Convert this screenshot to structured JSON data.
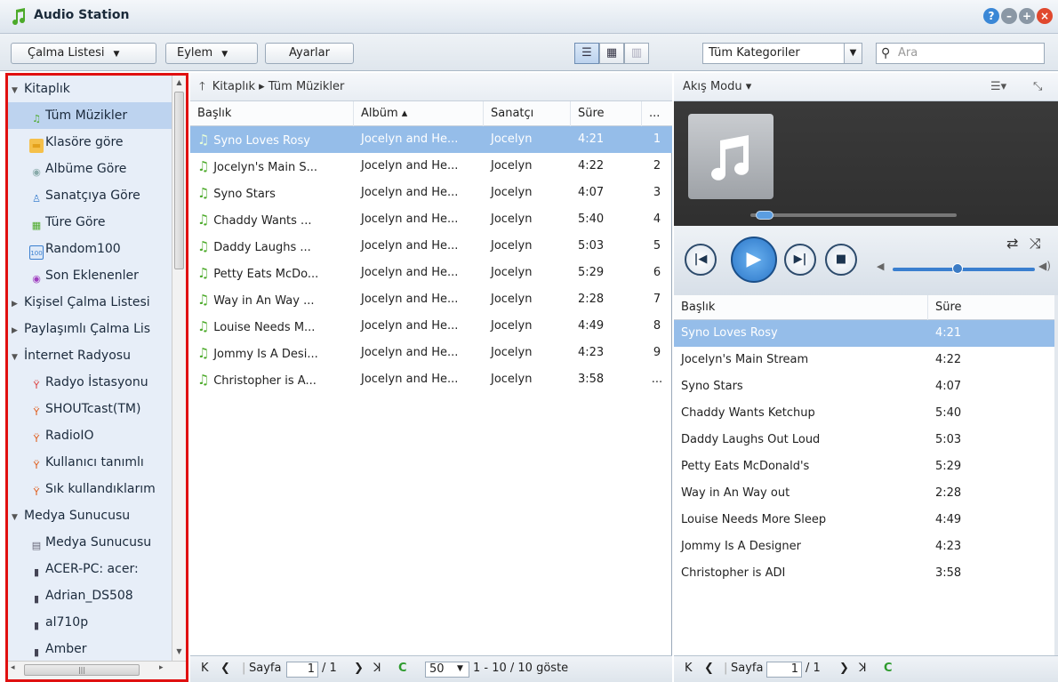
{
  "window": {
    "title": "Audio Station"
  },
  "toolbar": {
    "playlist_label": "Çalma Listesi",
    "action_label": "Eylem",
    "settings_label": "Ayarlar",
    "category_value": "Tüm Kategoriler",
    "search_placeholder": "Ara"
  },
  "sidebar": {
    "items": [
      {
        "label": "Kitaplık",
        "type": "group",
        "expanded": true
      },
      {
        "label": "Tüm Müzikler",
        "type": "item",
        "icon": "music-note-icon",
        "selected": true
      },
      {
        "label": "Klasöre göre",
        "type": "item",
        "icon": "folder-icon"
      },
      {
        "label": "Albüme Göre",
        "type": "item",
        "icon": "disc-icon"
      },
      {
        "label": "Sanatçıya Göre",
        "type": "item",
        "icon": "person-icon"
      },
      {
        "label": "Türe Göre",
        "type": "item",
        "icon": "genre-icon"
      },
      {
        "label": "Random100",
        "type": "item",
        "icon": "random100-icon"
      },
      {
        "label": "Son Eklenenler",
        "type": "item",
        "icon": "recent-icon"
      },
      {
        "label": "Kişisel Çalma Listesi",
        "type": "group",
        "expanded": false
      },
      {
        "label": "Paylaşımlı Çalma Lis",
        "type": "group",
        "expanded": false
      },
      {
        "label": "İnternet Radyosu",
        "type": "group",
        "expanded": true
      },
      {
        "label": "Radyo İstasyonu",
        "type": "item",
        "icon": "radio-add-icon"
      },
      {
        "label": "SHOUTcast(TM)",
        "type": "item",
        "icon": "radio-tower-icon"
      },
      {
        "label": "RadioIO",
        "type": "item",
        "icon": "radio-tower-icon"
      },
      {
        "label": "Kullanıcı tanımlı",
        "type": "item",
        "icon": "radio-tower-icon"
      },
      {
        "label": "Sık kullandıklarım",
        "type": "item",
        "icon": "radio-tower-icon"
      },
      {
        "label": "Medya Sunucusu",
        "type": "group",
        "expanded": true
      },
      {
        "label": "Medya Sunucusu",
        "type": "item",
        "icon": "media-server-icon"
      },
      {
        "label": "ACER-PC: acer:",
        "type": "item",
        "icon": "server-icon"
      },
      {
        "label": "Adrian_DS508",
        "type": "item",
        "icon": "server-icon"
      },
      {
        "label": "al710p",
        "type": "item",
        "icon": "server-icon"
      },
      {
        "label": "Amber",
        "type": "item",
        "icon": "server-icon"
      }
    ]
  },
  "library": {
    "breadcrumb": "Kitaplık ▸ Tüm Müzikler",
    "columns": [
      "Başlık",
      "Albüm ▴",
      "Sanatçı",
      "Süre",
      "..."
    ],
    "rows": [
      {
        "title": "Syno Loves Rosy",
        "album": "Jocelyn and He...",
        "artist": "Jocelyn",
        "duration": "4:21",
        "num": "1",
        "selected": true
      },
      {
        "title": "Jocelyn's Main S...",
        "album": "Jocelyn and He...",
        "artist": "Jocelyn",
        "duration": "4:22",
        "num": "2"
      },
      {
        "title": "Syno Stars",
        "album": "Jocelyn and He...",
        "artist": "Jocelyn",
        "duration": "4:07",
        "num": "3"
      },
      {
        "title": "Chaddy Wants ...",
        "album": "Jocelyn and He...",
        "artist": "Jocelyn",
        "duration": "5:40",
        "num": "4"
      },
      {
        "title": "Daddy Laughs ...",
        "album": "Jocelyn and He...",
        "artist": "Jocelyn",
        "duration": "5:03",
        "num": "5"
      },
      {
        "title": "Petty Eats McDo...",
        "album": "Jocelyn and He...",
        "artist": "Jocelyn",
        "duration": "5:29",
        "num": "6"
      },
      {
        "title": "Way in An Way ...",
        "album": "Jocelyn and He...",
        "artist": "Jocelyn",
        "duration": "2:28",
        "num": "7"
      },
      {
        "title": "Louise Needs M...",
        "album": "Jocelyn and He...",
        "artist": "Jocelyn",
        "duration": "4:49",
        "num": "8"
      },
      {
        "title": "Jommy Is A Desi...",
        "album": "Jocelyn and He...",
        "artist": "Jocelyn",
        "duration": "4:23",
        "num": "9"
      },
      {
        "title": "Christopher is A...",
        "album": "Jocelyn and He...",
        "artist": "Jocelyn",
        "duration": "3:58",
        "num": "..."
      }
    ],
    "pager": {
      "page_label": "Sayfa",
      "page": "1",
      "total": "/ 1",
      "per_page": "50",
      "summary": "1 - 10 / 10 göste"
    }
  },
  "player": {
    "mode_label": "Akış Modu ▾",
    "progress": 0.03,
    "volume": 0.45,
    "columns": [
      "Başlık",
      "Süre"
    ],
    "playlist": [
      {
        "title": "Syno Loves Rosy",
        "duration": "4:21",
        "selected": true
      },
      {
        "title": "Jocelyn's Main Stream",
        "duration": "4:22"
      },
      {
        "title": "Syno Stars",
        "duration": "4:07"
      },
      {
        "title": "Chaddy Wants Ketchup",
        "duration": "5:40"
      },
      {
        "title": "Daddy Laughs Out Loud",
        "duration": "5:03"
      },
      {
        "title": "Petty Eats McDonald's",
        "duration": "5:29"
      },
      {
        "title": "Way in An Way out",
        "duration": "2:28"
      },
      {
        "title": "Louise Needs More Sleep",
        "duration": "4:49"
      },
      {
        "title": "Jommy Is A Designer",
        "duration": "4:23"
      },
      {
        "title": "Christopher is ADI",
        "duration": "3:58"
      }
    ],
    "pager": {
      "page_label": "Sayfa",
      "page": "1",
      "total": "/ 1"
    }
  },
  "colors": {
    "selection": "#95bde9",
    "accent": "#2b76c8",
    "highlight_border": "#e01010"
  }
}
